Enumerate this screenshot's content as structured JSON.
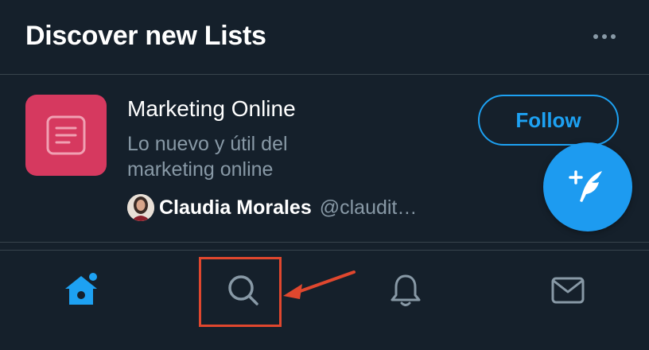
{
  "header": {
    "title": "Discover new Lists",
    "more_icon": "more-horizontal-icon"
  },
  "list": {
    "name": "Marketing Online",
    "description": "Lo nuevo y útil del marketing online",
    "thumb_color": "#d6395f",
    "thumb_icon": "list-document-icon",
    "owner": {
      "name": "Claudia Morales",
      "handle": "@claudit…"
    },
    "follow_label": "Follow"
  },
  "fab": {
    "icon": "compose-tweet-icon",
    "color": "#1d9bf0"
  },
  "tabs": [
    {
      "id": "home",
      "icon": "home-icon",
      "active": true
    },
    {
      "id": "search",
      "icon": "search-icon",
      "active": false
    },
    {
      "id": "notifications",
      "icon": "bell-icon",
      "active": false
    },
    {
      "id": "messages",
      "icon": "mail-icon",
      "active": false
    }
  ],
  "colors": {
    "background": "#15202b",
    "accent": "#1da1f2",
    "secondary_text": "#8899a6",
    "annotation": "#e0472e"
  }
}
